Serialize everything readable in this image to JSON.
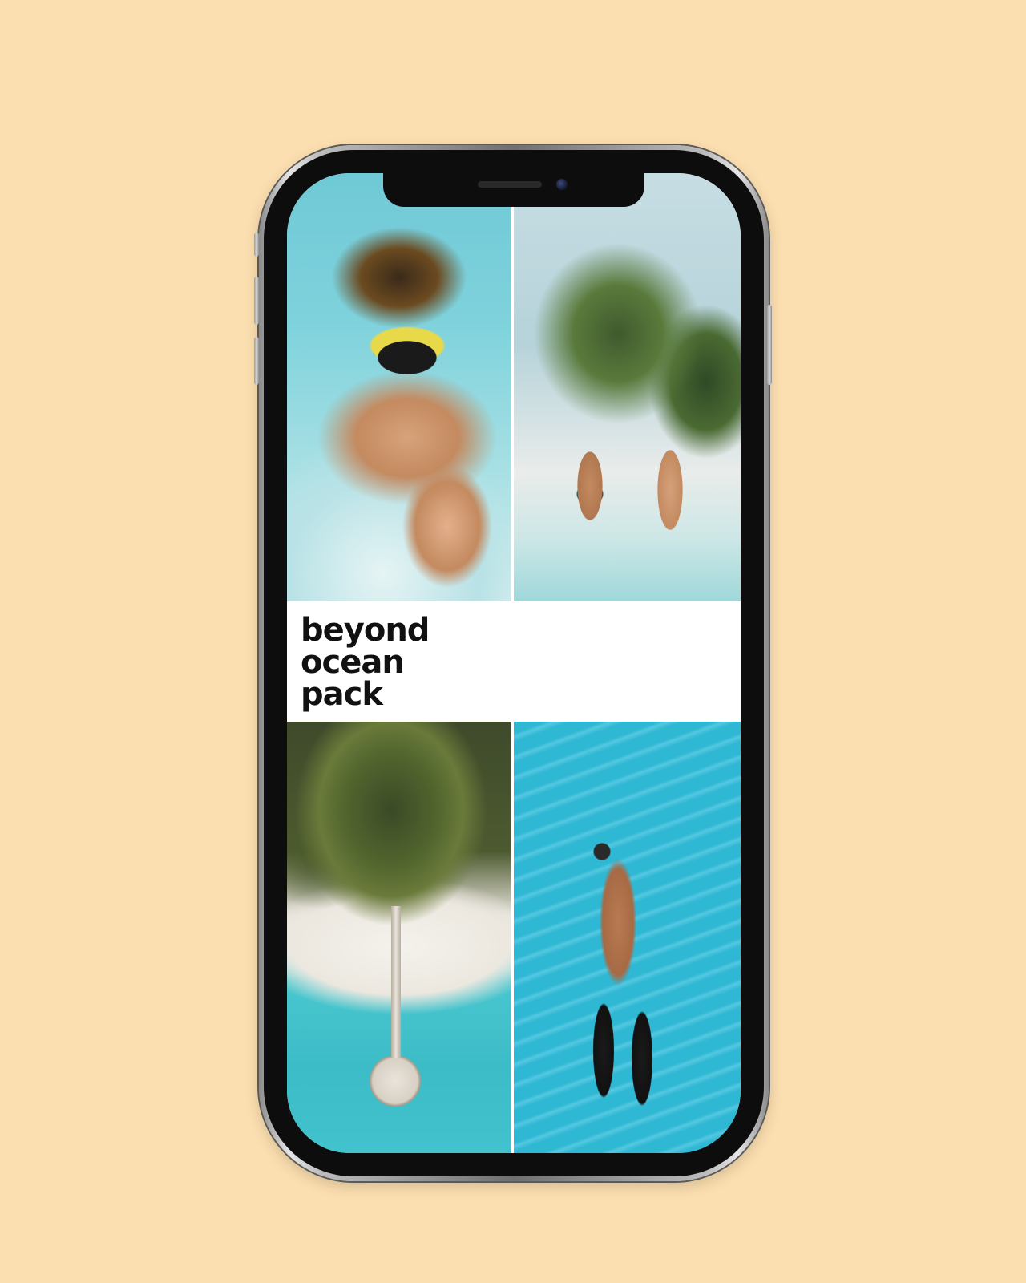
{
  "background_color": "#fcdfb0",
  "phone": {
    "frame_color": "#0d0d0d",
    "screen": {
      "title_lines": [
        "beyond",
        "ocean",
        "pack"
      ],
      "photos": [
        {
          "name": "snorkel-selfie-photo"
        },
        {
          "name": "couple-beach-palm-photo"
        },
        {
          "name": "aerial-island-pier-photo"
        },
        {
          "name": "freediver-sand-photo"
        }
      ]
    }
  }
}
